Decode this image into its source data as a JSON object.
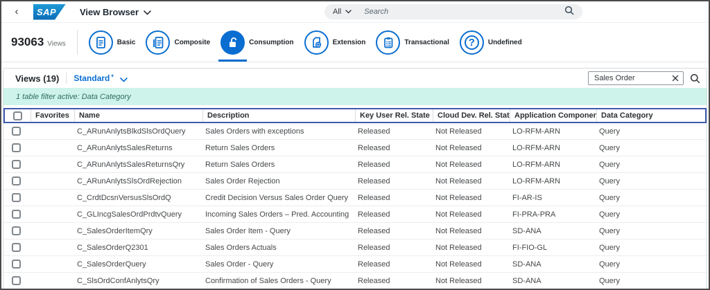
{
  "topbar": {
    "back_label": "‹",
    "logo_text": "SAP",
    "app_title": "View Browser",
    "search_scope": "All",
    "search_placeholder": "Search"
  },
  "toolbar": {
    "views_count": "93063",
    "views_count_label": "Views",
    "categories": [
      {
        "label": "Basic",
        "icon": "document-icon",
        "selected": false
      },
      {
        "label": "Composite",
        "icon": "documents-icon",
        "selected": false
      },
      {
        "label": "Consumption",
        "icon": "unlock-icon",
        "selected": true
      },
      {
        "label": "Extension",
        "icon": "document-plus-icon",
        "selected": false
      },
      {
        "label": "Transactional",
        "icon": "clipboard-list-icon",
        "selected": false
      },
      {
        "label": "Undefined",
        "icon": "question-mark-icon",
        "selected": false
      }
    ]
  },
  "panel": {
    "title": "Views (19)",
    "variant_label": "Standard",
    "variant_modified_marker": "*",
    "search_value": "Sales Order",
    "filter_message": "1 table filter active: Data Category"
  },
  "table": {
    "columns": [
      "Favorites",
      "Name",
      "Description",
      "Key User Rel. State",
      "Cloud Dev. Rel. State",
      "Application Component",
      "Data Category"
    ],
    "rows": [
      {
        "name": "C_ARunAnlytsBlkdSlsOrdQuery",
        "description": "Sales Orders with exceptions",
        "key_user_rel_state": "Released",
        "cloud_dev_rel_state": "Not Released",
        "application_component": "LO-RFM-ARN",
        "data_category": "Query"
      },
      {
        "name": "C_ARunAnlytsSalesReturns",
        "description": "Return Sales Orders",
        "key_user_rel_state": "Released",
        "cloud_dev_rel_state": "Not Released",
        "application_component": "LO-RFM-ARN",
        "data_category": "Query"
      },
      {
        "name": "C_ARunAnlytsSalesReturnsQry",
        "description": "Return Sales Orders",
        "key_user_rel_state": "Released",
        "cloud_dev_rel_state": "Not Released",
        "application_component": "LO-RFM-ARN",
        "data_category": "Query"
      },
      {
        "name": "C_ARunAnlytsSlsOrdRejection",
        "description": "Sales Order Rejection",
        "key_user_rel_state": "Released",
        "cloud_dev_rel_state": "Not Released",
        "application_component": "LO-RFM-ARN",
        "data_category": "Query"
      },
      {
        "name": "C_CrdtDcsnVersusSlsOrdQ",
        "description": "Credit Decision Versus Sales Order Query",
        "key_user_rel_state": "Released",
        "cloud_dev_rel_state": "Not Released",
        "application_component": "FI-AR-IS",
        "data_category": "Query"
      },
      {
        "name": "C_GLIncgSalesOrdPrdtvQuery",
        "description": "Incoming Sales Orders – Pred. Accounting",
        "key_user_rel_state": "Released",
        "cloud_dev_rel_state": "Not Released",
        "application_component": "FI-PRA-PRA",
        "data_category": "Query"
      },
      {
        "name": "C_SalesOrderItemQry",
        "description": "Sales Order Item - Query",
        "key_user_rel_state": "Released",
        "cloud_dev_rel_state": "Not Released",
        "application_component": "SD-ANA",
        "data_category": "Query"
      },
      {
        "name": "C_SalesOrderQ2301",
        "description": "Sales Orders Actuals",
        "key_user_rel_state": "Released",
        "cloud_dev_rel_state": "Not Released",
        "application_component": "FI-FIO-GL",
        "data_category": "Query"
      },
      {
        "name": "C_SalesOrderQuery",
        "description": "Sales Order - Query",
        "key_user_rel_state": "Released",
        "cloud_dev_rel_state": "Not Released",
        "application_component": "SD-ANA",
        "data_category": "Query"
      },
      {
        "name": "C_SlsOrdConfAnlytsQry",
        "description": "Confirmation of Sales Orders - Query",
        "key_user_rel_state": "Released",
        "cloud_dev_rel_state": "Not Released",
        "application_component": "SD-ANA",
        "data_category": "Query"
      }
    ]
  },
  "colors": {
    "accent_blue": "#0a6ed1",
    "header_focus_border": "#3e5bab",
    "filter_bar_bg": "#cdf3ea",
    "filter_bar_text": "#2f6b60",
    "logo_blue": "#0b6cb8",
    "frame_border": "#4a4a4a"
  }
}
